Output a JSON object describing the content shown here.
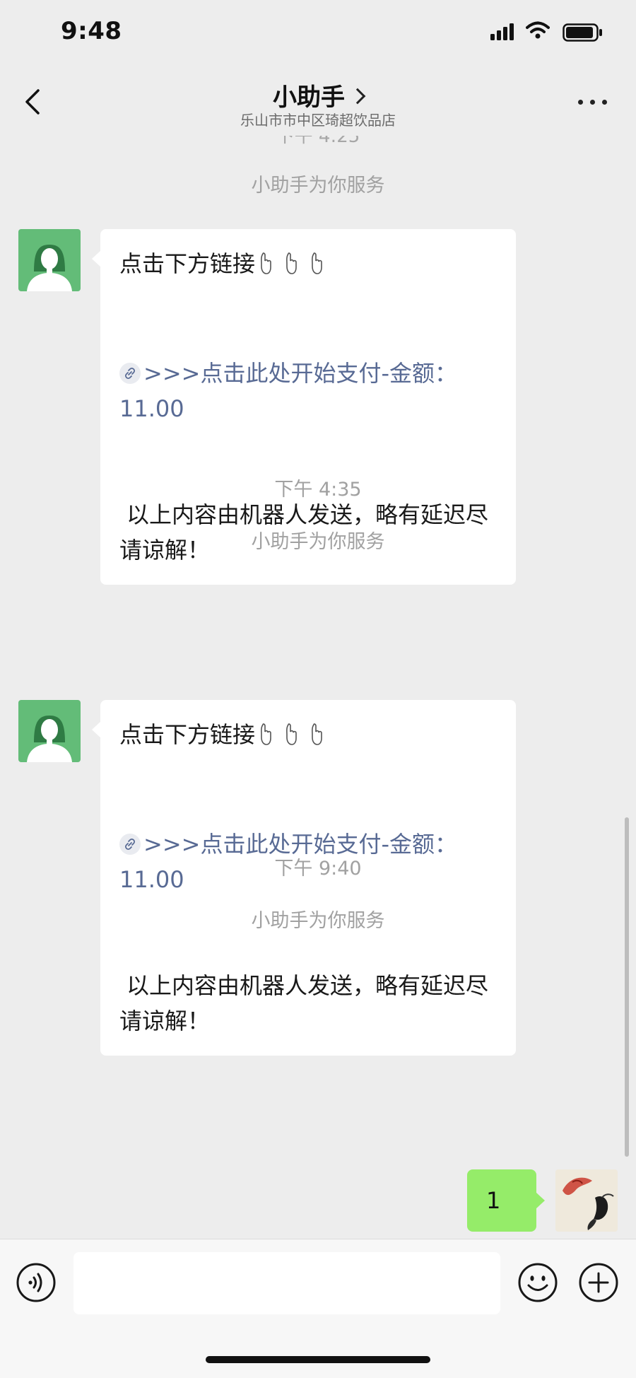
{
  "status_bar": {
    "time": "9:48"
  },
  "header": {
    "title": "小助手",
    "subtitle": "乐山市市中区琦超饮品店"
  },
  "chat": {
    "peek_time": "下午 4:25",
    "messages": [
      {
        "system_text": "小助手为你服务",
        "line1": "点击下方链接",
        "link_text": ">>>点击此处开始支付-金额：11.00",
        "footer_text": "以上内容由机器人发送，略有延迟尽请谅解！"
      },
      {
        "timestamp": "下午 4:35",
        "system_text": "小助手为你服务",
        "line1": "点击下方链接",
        "link_text": ">>>点击此处开始支付-金额：11.00",
        "footer_text": "以上内容由机器人发送，略有延迟尽请谅解！"
      },
      {
        "timestamp": "下午 9:40",
        "system_text": "小助手为你服务",
        "sent_text": "1"
      }
    ]
  },
  "input_bar": {
    "placeholder": ""
  },
  "icons": {
    "back": "chevron-left-icon",
    "more": "more-dots-icon",
    "link": "link-icon",
    "hand": "pointing-down-hand-icon",
    "voice": "voice-icon",
    "emoji": "emoji-icon",
    "plus": "plus-icon"
  },
  "colors": {
    "background": "#ededed",
    "sent_bubble": "#95ec69",
    "link": "#586a94",
    "avatar_green": "#63bc78"
  }
}
